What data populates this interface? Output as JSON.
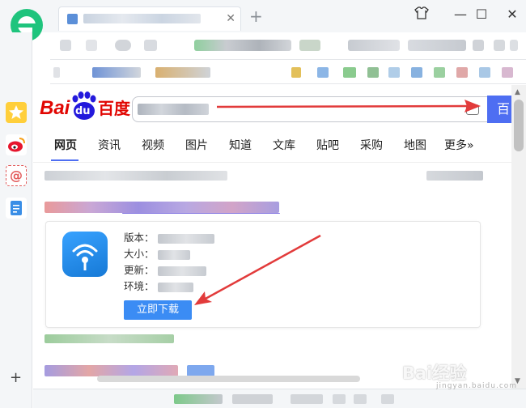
{
  "browser": {
    "window_controls": [
      "⌃",
      "—",
      "☐",
      "✕"
    ]
  },
  "baidu": {
    "logo_text_left": "Bai",
    "logo_text_du": "du",
    "logo_text_right": "百度",
    "search_button": "百"
  },
  "nav_tabs": [
    "网页",
    "资讯",
    "视频",
    "图片",
    "知道",
    "文库",
    "贴吧",
    "采购",
    "地图",
    "更多»"
  ],
  "app_card": {
    "labels": [
      "版本：",
      "大小：",
      "更新：",
      "环境："
    ],
    "download_button": "立即下载"
  },
  "left_rail": {
    "add": "+"
  },
  "watermark": {
    "text": "Bai经验",
    "sub": "jingyan.baidu.com"
  },
  "colors": {
    "accent": "#4e6ef2",
    "download_button": "#3b8cf4",
    "arrow": "#e23b3b",
    "logo_green": "#1fc47d"
  }
}
